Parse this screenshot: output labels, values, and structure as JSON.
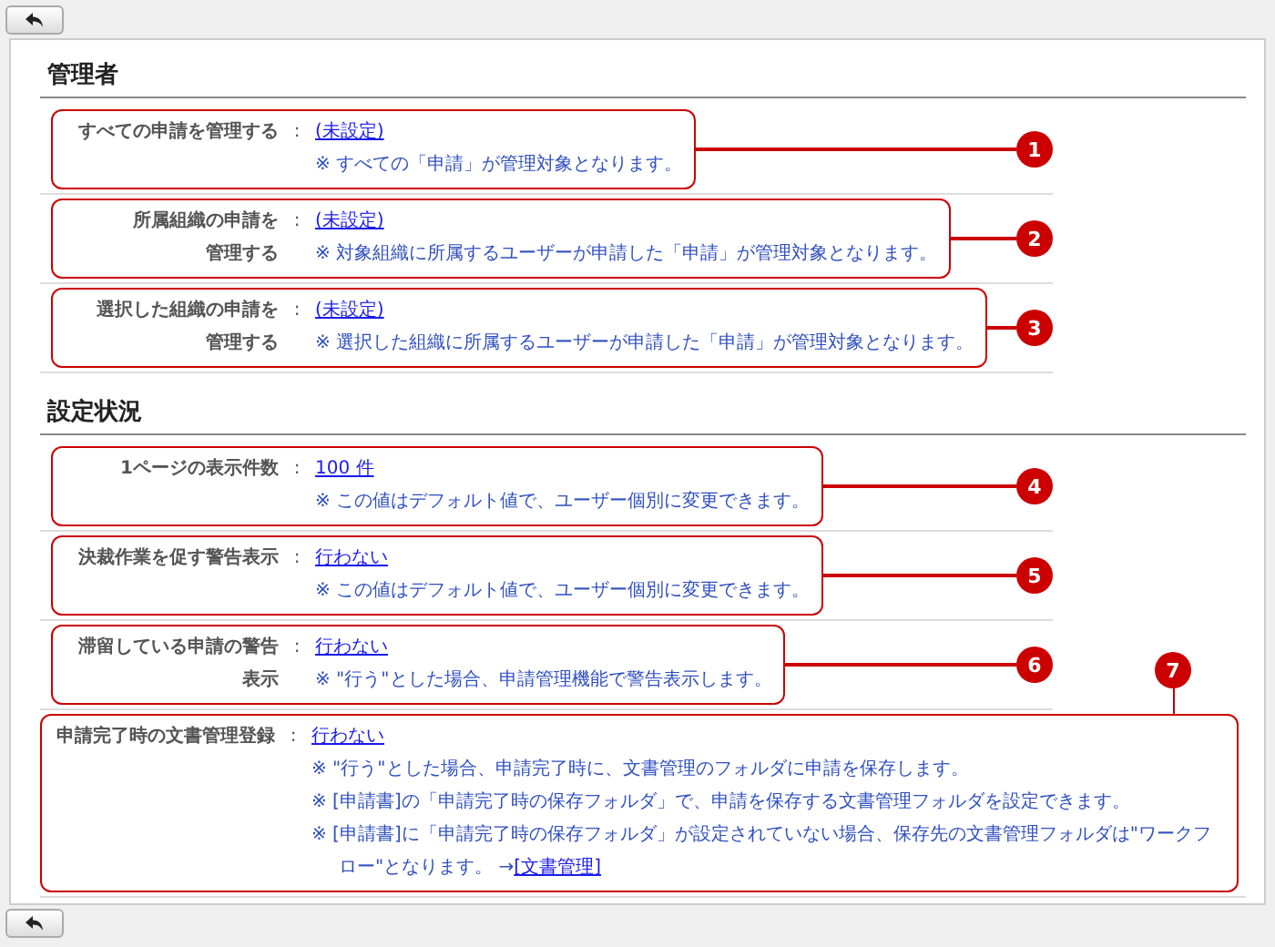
{
  "sections": [
    {
      "title": "管理者",
      "rows": [
        {
          "kind": "normal",
          "callout": "1",
          "label_lines": [
            "すべての申請を管理する"
          ],
          "separator": ":",
          "value": "(未設定)",
          "notes": [
            {
              "text": "※ すべての「申請」が管理対象となります。"
            }
          ]
        },
        {
          "kind": "normal",
          "callout": "2",
          "label_lines": [
            "所属組織の申請を",
            "管理する"
          ],
          "separator": ":",
          "value": "(未設定)",
          "notes": [
            {
              "text": "※ 対象組織に所属するユーザーが申請した「申請」が管理対象となります。"
            }
          ]
        },
        {
          "kind": "normal",
          "callout": "3",
          "label_lines": [
            "選択した組織の申請を",
            "管理する"
          ],
          "separator": ":",
          "value": "(未設定)",
          "notes": [
            {
              "text": "※ 選択した組織に所属するユーザーが申請した「申請」が管理対象となります。"
            }
          ]
        }
      ]
    },
    {
      "title": "設定状況",
      "rows": [
        {
          "kind": "normal",
          "callout": "4",
          "label_lines": [
            "1ページの表示件数"
          ],
          "separator": ":",
          "value": "100 件",
          "notes": [
            {
              "text": "※ この値はデフォルト値で、ユーザー個別に変更できます。"
            }
          ]
        },
        {
          "kind": "normal",
          "callout": "5",
          "label_lines": [
            "決裁作業を促す警告表示"
          ],
          "separator": ":",
          "value": "行わない",
          "notes": [
            {
              "text": "※ この値はデフォルト値で、ユーザー個別に変更できます。"
            }
          ]
        },
        {
          "kind": "normal",
          "callout": "6",
          "label_lines": [
            "滞留している申請の警告",
            "表示"
          ],
          "separator": ":",
          "value": "行わない",
          "notes": [
            {
              "text": "※ \"行う\"とした場合、申請管理機能で警告表示します。"
            }
          ]
        },
        {
          "kind": "wide",
          "callout": "7",
          "label_lines": [
            "申請完了時の文書管理登録"
          ],
          "separator": ":",
          "value": "行わない",
          "notes": [
            {
              "text": "※ \"行う\"とした場合、申請完了時に、文書管理のフォルダに申請を保存します。"
            },
            {
              "text": "※ [申請書]の「申請完了時の保存フォルダ」で、申請を保存する文書管理フォルダを設定できます。"
            },
            {
              "text": "※ [申請書]に「申請完了時の保存フォルダ」が設定されていない場合、保存先の文書管理フォルダは\"ワークフロー\"となります。 →",
              "link": "[文書管理]"
            }
          ]
        }
      ]
    }
  ]
}
